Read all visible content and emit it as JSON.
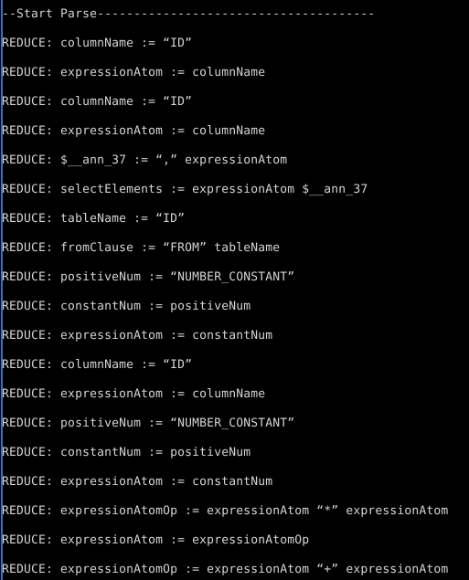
{
  "window": {
    "title": "Parser Console Output",
    "background_color": "#000000",
    "text_color": "#d4d4d4",
    "accent_color": "#3073c4"
  },
  "console": {
    "header": "--Start Parse--------------------------------------",
    "lines": [
      "REDUCE: columnName := “ID”",
      "REDUCE: expressionAtom := columnName",
      "REDUCE: columnName := “ID”",
      "REDUCE: expressionAtom := columnName",
      "REDUCE: $__ann_37 := “,” expressionAtom",
      "REDUCE: selectElements := expressionAtom $__ann_37",
      "REDUCE: tableName := “ID”",
      "REDUCE: fromClause := “FROM” tableName",
      "REDUCE: positiveNum := “NUMBER_CONSTANT”",
      "REDUCE: constantNum := positiveNum",
      "REDUCE: expressionAtom := constantNum",
      "REDUCE: columnName := “ID”",
      "REDUCE: expressionAtom := columnName",
      "REDUCE: positiveNum := “NUMBER_CONSTANT”",
      "REDUCE: constantNum := positiveNum",
      "REDUCE: expressionAtom := constantNum",
      "REDUCE: expressionAtomOp := expressionAtom “*” expressionAtom",
      "REDUCE: expressionAtom := expressionAtomOp",
      "REDUCE: expressionAtomOp := expressionAtom “+” expressionAtom"
    ]
  }
}
